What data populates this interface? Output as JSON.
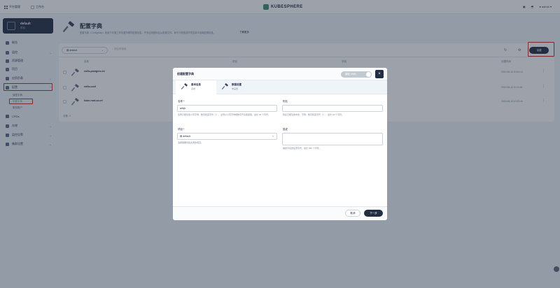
{
  "topbar": {
    "nav_platform": "平台管理",
    "nav_workbench": "工作台",
    "logo": "KUBESPHERE",
    "user": "admin"
  },
  "workspace": {
    "name": "default",
    "sub": "项目"
  },
  "sidebar": {
    "items": [
      {
        "label": "概览"
      },
      {
        "label": "监控"
      },
      {
        "label": "资源管理"
      },
      {
        "label": "项目"
      },
      {
        "label": "应用负载"
      },
      {
        "label": "配置"
      },
      {
        "label": "CRDs"
      },
      {
        "label": "存储"
      },
      {
        "label": "监控告警"
      },
      {
        "label": "集群设置"
      }
    ],
    "config_sub": [
      "保密字典",
      "配置字典",
      "服务账户"
    ]
  },
  "header": {
    "title": "配置字典",
    "desc": "配置字典（ConfigMap）常用于存储工作负载所需的配置信息，许多应用程序会从配置文件、命令行参数或环境变量中读取配置信息。",
    "learn_more": "了解更多"
  },
  "toolbar": {
    "project": "default",
    "search_placeholder": "按名称搜索",
    "create_label": "创建"
  },
  "table": {
    "columns": [
      "名称",
      "项目",
      "字段",
      "创建时间"
    ],
    "rows": [
      {
        "name": "redis-postgres-ini",
        "time": "2020-06-10 10:04:14"
      },
      {
        "name": "redis-conf",
        "time": "2020-06-10 10:11:46"
      },
      {
        "name": "kube-root-ca.crt",
        "time": "2020-06-10 10:23:43"
      }
    ],
    "total": "总数: 3"
  },
  "dialog": {
    "title": "创建配置字典",
    "yaml_toggle": "编辑 YAML",
    "close_icon": "×",
    "tabs": [
      {
        "label": "基本信息",
        "sub": "完成"
      },
      {
        "label": "数据设置",
        "sub": "未设置"
      }
    ],
    "name_label": "名称 *",
    "name_value": "ankjv",
    "name_help": "名称只能包含小写字母、数字和连字符（-），必须以小写字母或数字开头和结尾，最长 63 个字符。",
    "alias_label": "别名",
    "alias_help": "别名只能包含中文、字母、数字和连字符（-），最长 63 个字符。",
    "project_label": "项目 *",
    "project_value": "default",
    "project_help": "选择需要创建资源的项目。",
    "desc_label": "描述",
    "desc_help": "描述可包含任意字符，最长 256 个字符。",
    "cancel_label": "取消",
    "next_label": "下一步"
  },
  "colors": {
    "accent": "#242e42",
    "highlight": "#ca2621",
    "active_green": "#55bc8a"
  }
}
